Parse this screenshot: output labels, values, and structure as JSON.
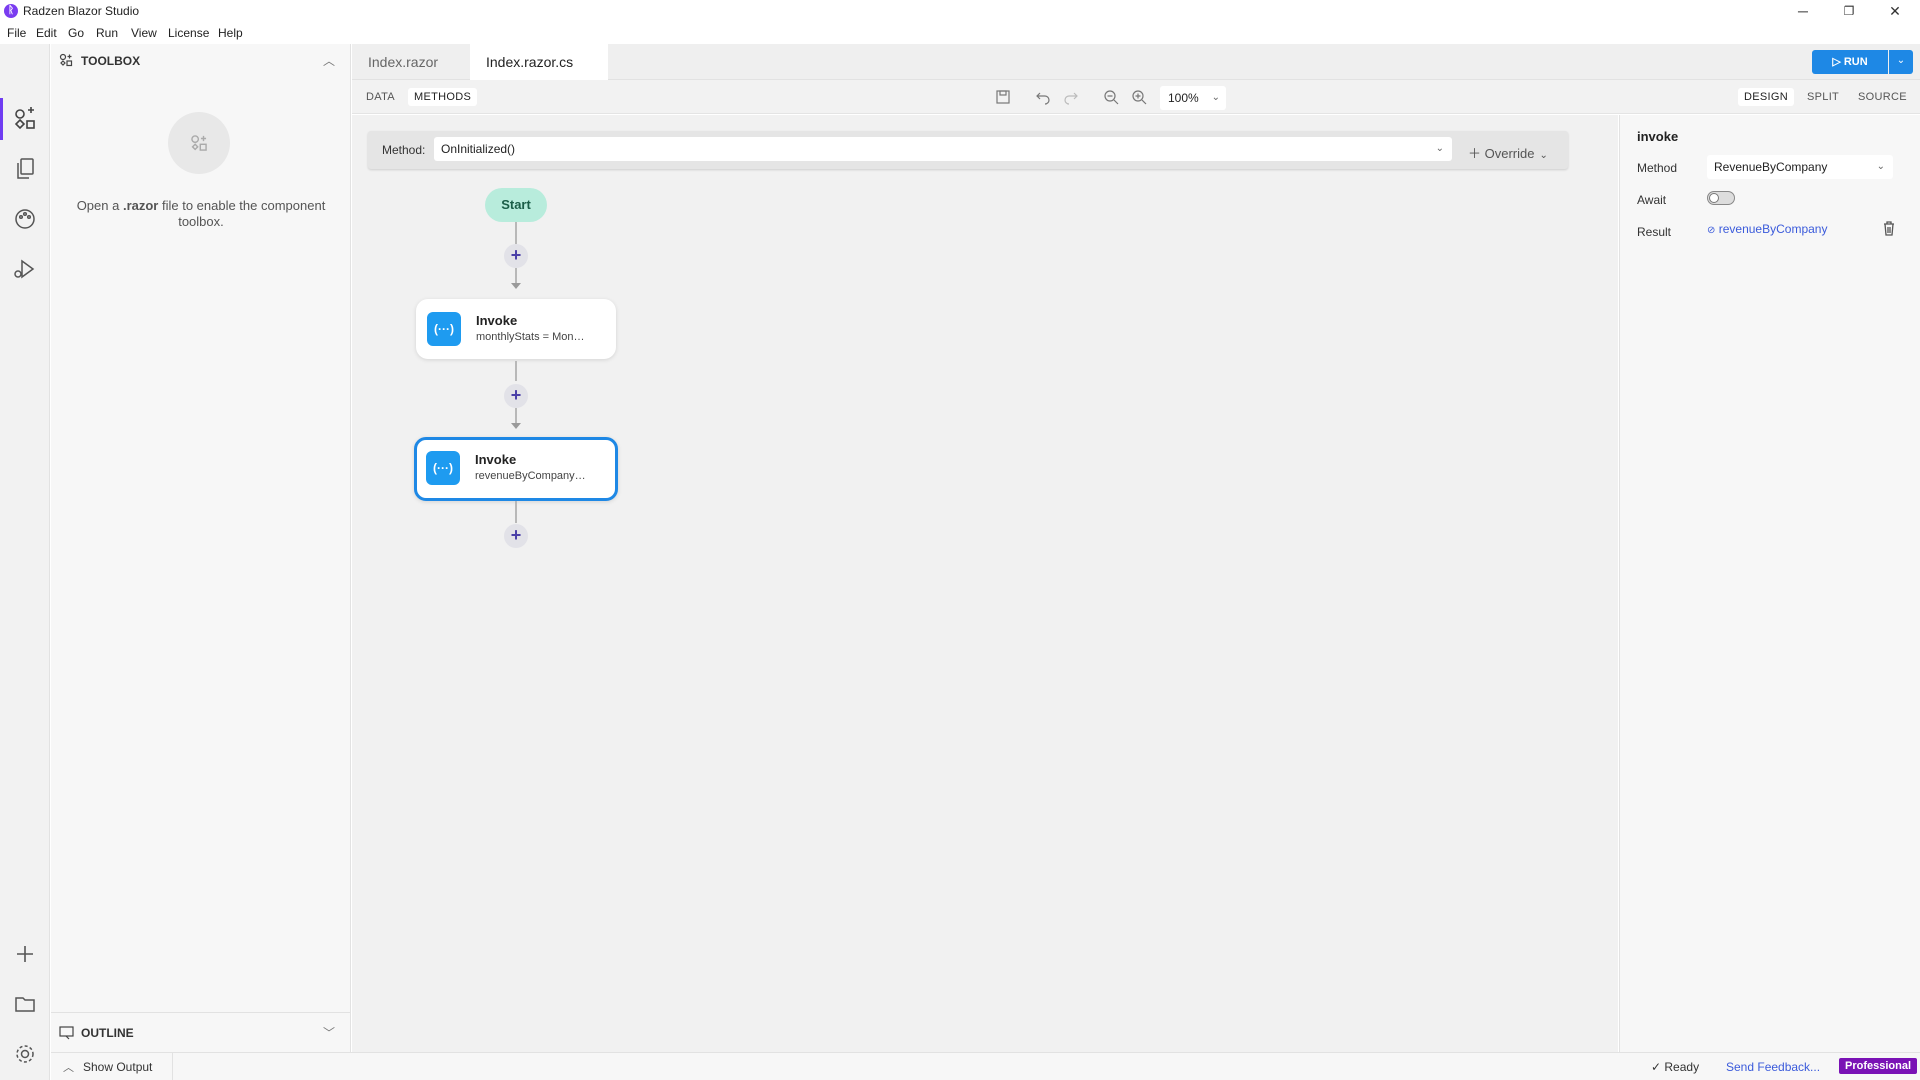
{
  "window": {
    "title": "Radzen Blazor Studio",
    "controls": {
      "minimize": "─",
      "restore": "❐",
      "close": "✕"
    }
  },
  "menu": [
    "File",
    "Edit",
    "Go",
    "Run",
    "View",
    "License",
    "Help"
  ],
  "sidebar": {
    "toolbox_title": "TOOLBOX",
    "empty_text_prefix": "Open a ",
    "empty_text_bold": ".razor",
    "empty_text_suffix": " file to enable the component toolbox.",
    "outline_title": "OUTLINE"
  },
  "tabs": [
    {
      "label": "Index.razor",
      "active": false
    },
    {
      "label": "Index.razor.cs",
      "active": true,
      "modified": true
    }
  ],
  "run_button": {
    "label": "RUN"
  },
  "toolbar": {
    "left_tabs": [
      "DATA",
      "METHODS"
    ],
    "active_left_tab": "METHODS",
    "zoom": "100%",
    "view_tabs": [
      "DESIGN",
      "SPLIT",
      "SOURCE"
    ],
    "active_view_tab": "DESIGN"
  },
  "method_bar": {
    "label": "Method:",
    "value": "OnInitialized()",
    "override_label": "Override"
  },
  "flow": {
    "start_label": "Start",
    "nodes": [
      {
        "title": "Invoke",
        "subtitle": "monthlyStats = Mon…",
        "selected": false
      },
      {
        "title": "Invoke",
        "subtitle": "revenueByCompany…",
        "selected": true
      }
    ]
  },
  "properties": {
    "title": "invoke",
    "method_label": "Method",
    "method_value": "RevenueByCompany",
    "await_label": "Await",
    "await_on": false,
    "result_label": "Result",
    "result_value": "revenueByCompany"
  },
  "statusbar": {
    "show_output": "Show Output",
    "ready": "Ready",
    "feedback": "Send Feedback...",
    "edition": "Professional"
  },
  "colors": {
    "accent": "#1e88e5",
    "brand": "#6f3cf2",
    "start_node": "#b8ecdc",
    "edition_badge": "#7a12b5"
  }
}
